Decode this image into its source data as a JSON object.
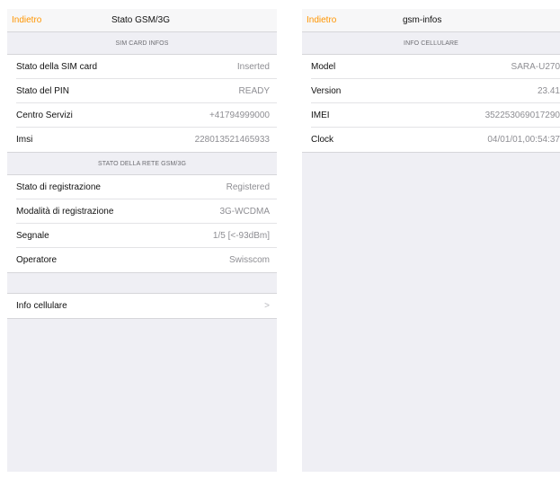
{
  "left": {
    "nav": {
      "back_label": "Indietro",
      "title": "Stato GSM/3G"
    },
    "sim_section": {
      "header": "SIM CARD INFOS",
      "rows": [
        {
          "label": "Stato della SIM card",
          "value": "Inserted"
        },
        {
          "label": "Stato del PIN",
          "value": "READY"
        },
        {
          "label": "Centro Servizi",
          "value": "+41794999000"
        },
        {
          "label": "Imsi",
          "value": "228013521465933"
        }
      ]
    },
    "network_section": {
      "header": "STATO DELLA RETE GSM/3G",
      "rows": [
        {
          "label": "Stato di registrazione",
          "value": "Registered"
        },
        {
          "label": "Modalità di registrazione",
          "value": "3G-WCDMA"
        },
        {
          "label": "Segnale",
          "value": "1/5 [<-93dBm]"
        },
        {
          "label": "Operatore",
          "value": "Swisscom"
        }
      ]
    },
    "link_row": {
      "label": "Info cellulare",
      "chevron": ">"
    }
  },
  "right": {
    "nav": {
      "back_label": "Indietro",
      "title": "gsm-infos"
    },
    "info_section": {
      "header": "INFO CELLULARE",
      "rows": [
        {
          "label": "Model",
          "value": "SARA-U270"
        },
        {
          "label": "Version",
          "value": "23.41"
        },
        {
          "label": "IMEI",
          "value": "352253069017290"
        },
        {
          "label": "Clock",
          "value": "04/01/01,00:54:37"
        }
      ]
    }
  },
  "colors": {
    "accent": "#ff9500",
    "background": "#efeff4",
    "value_text": "#8e8e93"
  }
}
